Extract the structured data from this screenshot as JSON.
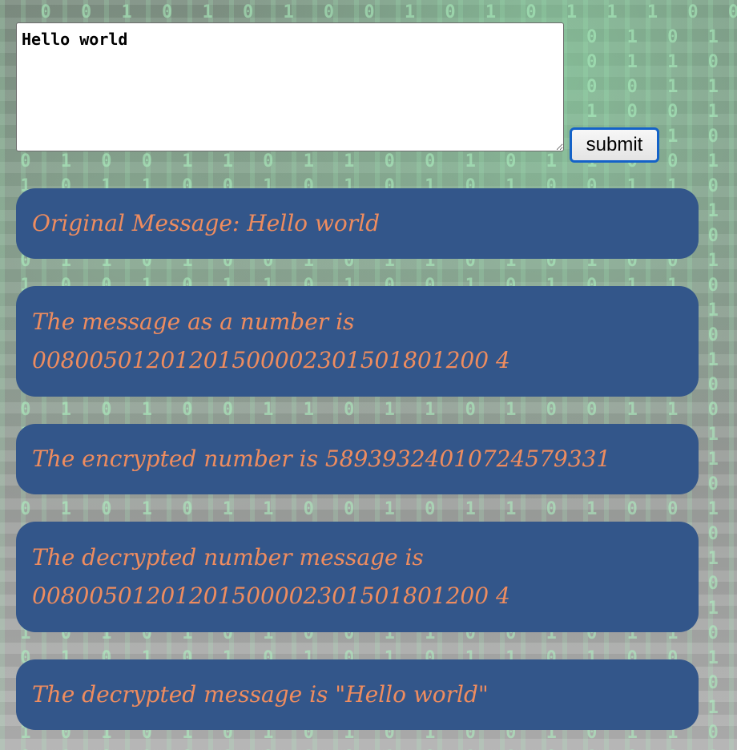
{
  "form": {
    "message_value": "Hello world",
    "submit_label": "submit"
  },
  "results": {
    "original": "Original Message: Hello world",
    "as_number_label": "The message as a number is",
    "as_number_value": "00800501201201500002301501801200 4",
    "encrypted": "The encrypted number is 58939324010724579331",
    "decrypted_number_label": "The decrypted number message is",
    "decrypted_number_value": "00800501201201500002301501801200 4",
    "decrypted_message": "The decrypted message is \"Hello world\""
  },
  "colors": {
    "box_background": "#33568a",
    "text": "#ee8c5f",
    "button_border": "#1462c8"
  }
}
